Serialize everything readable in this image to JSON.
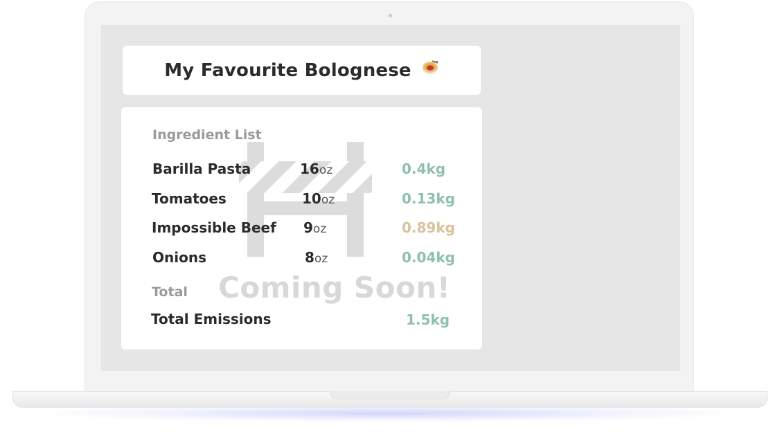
{
  "recipe": {
    "title": "My Favourite Bolognese",
    "emoji": "🍝"
  },
  "ingredients": {
    "section_label": "Ingredient List",
    "items": [
      {
        "name": "Barilla Pasta",
        "qty": "16",
        "unit": "oz",
        "emissions": "0.4kg",
        "emissions_color": "#8fbfae"
      },
      {
        "name": "Tomatoes",
        "qty": "10",
        "unit": "oz",
        "emissions": "0.13kg",
        "emissions_color": "#8fbfae"
      },
      {
        "name": "Impossible Beef",
        "qty": "9",
        "unit": "oz",
        "emissions": "0.89kg",
        "emissions_color": "#d8c39c"
      },
      {
        "name": "Onions",
        "qty": "8",
        "unit": "oz",
        "emissions": "0.04kg",
        "emissions_color": "#8fbfae"
      }
    ]
  },
  "total": {
    "section_label": "Total",
    "label": "Total Emissions",
    "value": "1.5kg",
    "color": "#8fbfae"
  },
  "overlay": {
    "text": "Coming Soon!",
    "icon": "construction-barrier-icon"
  }
}
